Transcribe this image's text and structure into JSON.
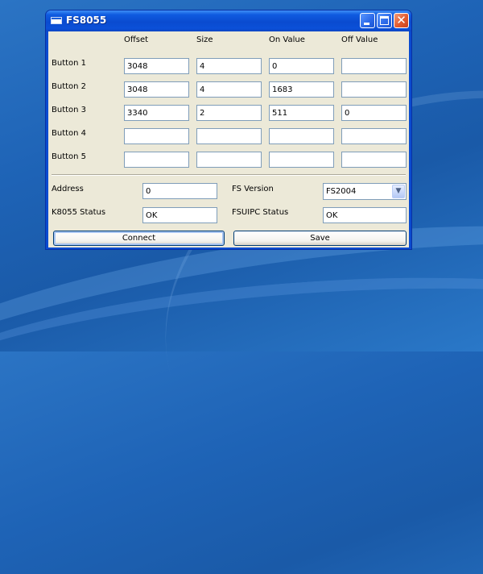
{
  "window": {
    "title": "FS8055"
  },
  "columns": [
    "Offset",
    "Size",
    "On Value",
    "Off Value"
  ],
  "rows": [
    {
      "label": "Button 1",
      "offset": "3048",
      "size": "4",
      "on_value": "0",
      "off_value": ""
    },
    {
      "label": "Button 2",
      "offset": "3048",
      "size": "4",
      "on_value": "1683",
      "off_value": ""
    },
    {
      "label": "Button 3",
      "offset": "3340",
      "size": "2",
      "on_value": "511",
      "off_value": "0"
    },
    {
      "label": "Button 4",
      "offset": "",
      "size": "",
      "on_value": "",
      "off_value": ""
    },
    {
      "label": "Button 5",
      "offset": "",
      "size": "",
      "on_value": "",
      "off_value": ""
    }
  ],
  "settings": {
    "address_label": "Address",
    "address_value": "0",
    "k8055_status_label": "K8055 Status",
    "k8055_status_value": "OK",
    "fs_version_label": "FS Version",
    "fs_version_value": "FS2004",
    "fsuipc_status_label": "FSUIPC Status",
    "fsuipc_status_value": "OK"
  },
  "buttons": {
    "connect": "Connect",
    "save": "Save"
  },
  "icons": {
    "minimize": "minimize-icon",
    "maximize": "maximize-icon",
    "close": "close-icon",
    "dropdown": "chevron-down-icon"
  },
  "colors": {
    "titlebar": "#0a4bd0",
    "client": "#ece9d8",
    "close_button": "#e25b2f",
    "desktop": "#1e63b6"
  }
}
